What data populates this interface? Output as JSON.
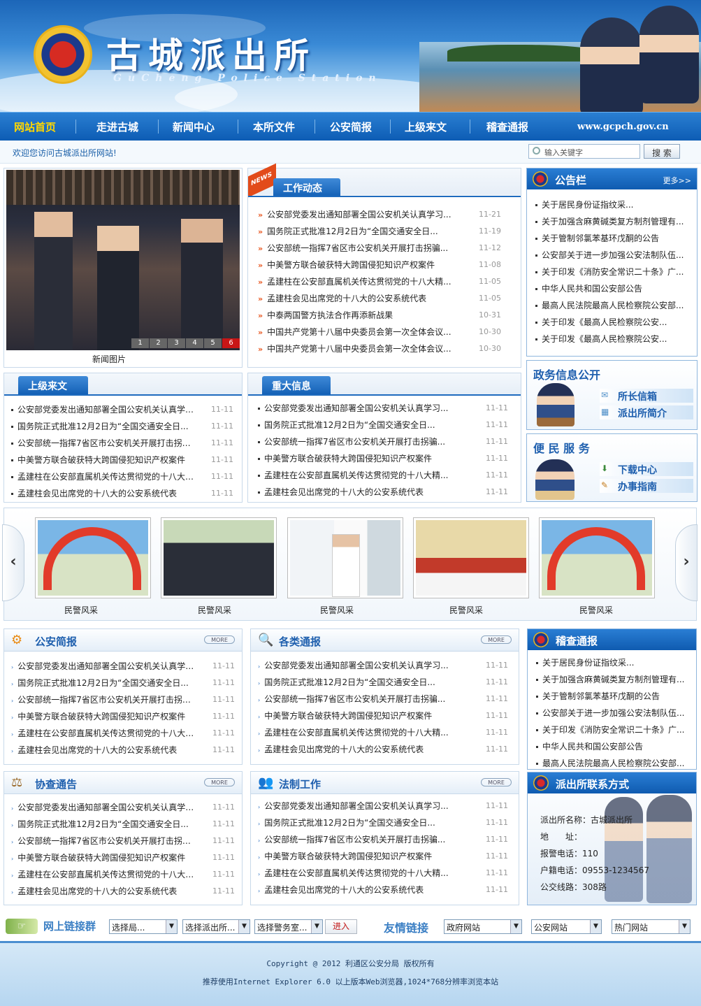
{
  "header": {
    "title": "古城派出所",
    "subtitle": "GuCheng Police Station"
  },
  "nav": {
    "items": [
      "网站首页",
      "走进古城",
      "新闻中心",
      "本所文件",
      "公安简报",
      "上级来文",
      "稽查通报"
    ],
    "url": "www.gcpch.gov.cn"
  },
  "welcome": "欢迎您访问古城派出所网站!",
  "search": {
    "placeholder": "输入关键字",
    "button": "搜 索"
  },
  "news_photo": {
    "caption": "新闻图片",
    "pages": [
      "1",
      "2",
      "3",
      "4",
      "5",
      "6"
    ]
  },
  "work": {
    "title": "工作动态",
    "badge": "NEWS",
    "items": [
      {
        "t": "公安部党委发出通知部署全国公安机关认真学习...",
        "d": "11-21"
      },
      {
        "t": "国务院正式批准12月2日为“全国交通安全日...",
        "d": "11-19"
      },
      {
        "t": "公安部统一指挥7省区市公安机关开展打击拐骗...",
        "d": "11-12"
      },
      {
        "t": "中美警方联合破获特大跨国侵犯知识产权案件",
        "d": "11-08"
      },
      {
        "t": "孟建柱在公安部直属机关传达贯彻党的十八大精...",
        "d": "11-05"
      },
      {
        "t": "孟建柱会见出席党的十八大的公安系统代表",
        "d": "11-05"
      },
      {
        "t": "中泰两国警方执法合作再添新战果",
        "d": "10-31"
      },
      {
        "t": "中国共产党第十八届中央委员会第一次全体会议...",
        "d": "10-30"
      },
      {
        "t": "中国共产党第十八届中央委员会第一次全体会议...",
        "d": "10-30"
      }
    ]
  },
  "notice": {
    "title": "公告栏",
    "more": "更多>>",
    "items": [
      "关于居民身份证指纹采...",
      "关于加强含麻黄碱类复方制剂管理有...",
      "关于管制邻氯苯基环戊酮的公告",
      "公安部关于进一步加强公安法制队伍...",
      "关于印发《消防安全常识二十条》广...",
      "中华人民共和国公安部公告",
      "最高人民法院最高人民检察院公安部...",
      "关于印发《最高人民检察院公安...",
      "关于印发《最高人民检察院公安..."
    ]
  },
  "common_items": [
    {
      "t": "公安部党委发出通知部署全国公安机关认真学习...",
      "d": "11-11"
    },
    {
      "t": "国务院正式批准12月2日为“全国交通安全日...",
      "d": "11-11"
    },
    {
      "t": "公安部统一指挥7省区市公安机关开展打击拐骗...",
      "d": "11-11"
    },
    {
      "t": "中美警方联合破获特大跨国侵犯知识产权案件",
      "d": "11-11"
    },
    {
      "t": "孟建柱在公安部直属机关传达贯彻党的十八大精...",
      "d": "11-11"
    },
    {
      "t": "孟建柱会见出席党的十八大的公安系统代表",
      "d": "11-11"
    }
  ],
  "upper": {
    "title": "上级来文"
  },
  "major": {
    "title": "重大信息"
  },
  "gov": {
    "title": "政务信息公开",
    "links": [
      "所长信箱",
      "派出所简介"
    ]
  },
  "service": {
    "title": "便 民 服 务",
    "links": [
      "下载中心",
      "办事指南"
    ]
  },
  "gallery": {
    "items": [
      "民警风采",
      "民警风采",
      "民警风采",
      "民警风采",
      "民警风采"
    ],
    "prev": "‹",
    "next": "›"
  },
  "sections": {
    "brief": "公安简报",
    "reports": "各类通报",
    "assist": "协查通告",
    "legal": "法制工作",
    "more": "MORE"
  },
  "inspect": {
    "title": "稽查通报",
    "items": [
      "关于居民身份证指纹采...",
      "关于加强含麻黄碱类复方制剂管理有...",
      "关于管制邻氯苯基环戊酮的公告",
      "公安部关于进一步加强公安法制队伍...",
      "关于印发《消防安全常识二十条》广...",
      "中华人民共和国公安部公告",
      "最高人民法院最高人民检察院公安部..."
    ]
  },
  "contact": {
    "title": "派出所联系方式",
    "rows": [
      {
        "k": "派出所名称：",
        "v": "古城派出所"
      },
      {
        "k": "地　　址：",
        "v": ""
      },
      {
        "k": "报警电话：",
        "v": "110"
      },
      {
        "k": "户籍电话：",
        "v": "09553-1234567"
      },
      {
        "k": "公交线路：",
        "v": "308路"
      }
    ]
  },
  "links": {
    "group_label": "网上链接群",
    "sel1": "选择局...",
    "sel2": "选择派出所...",
    "sel3": "选择警务室...",
    "go": "进入",
    "friend_label": "友情链接",
    "f1": "政府网站",
    "f2": "公安网站",
    "f3": "热门网站"
  },
  "footer": {
    "copyright": "Copyright @ 2012 利通区公安分局 版权所有",
    "tip": "推荐使用Internet Explorer 6.0 以上版本Web浏览器,1024*768分辨率浏览本站"
  },
  "colors": {
    "primary": "#1461b6",
    "accent": "#e8541c",
    "nav_active": "#ffd700"
  }
}
